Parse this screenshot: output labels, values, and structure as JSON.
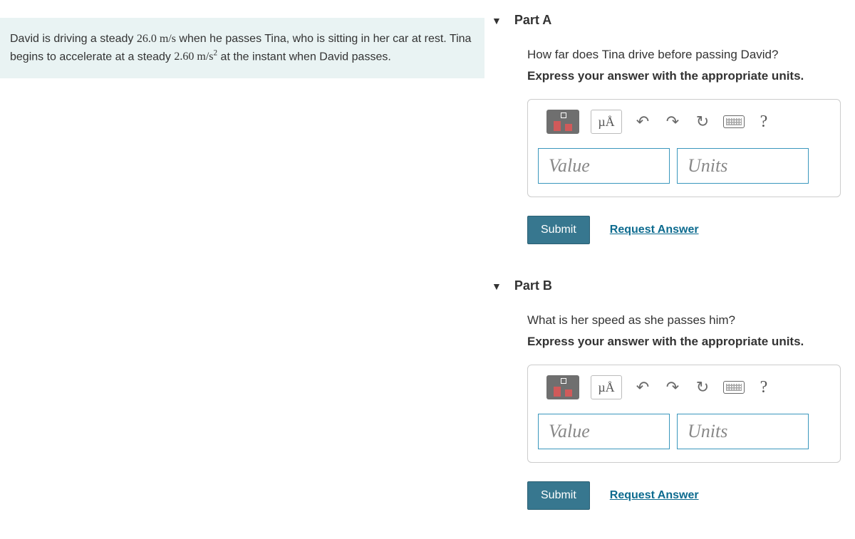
{
  "problem": {
    "text_before_v1": "David is driving a steady ",
    "v1": "26.0 m/s",
    "text_mid1": " when he passes Tina, who is sitting in her car at rest. Tina begins to accelerate at a steady ",
    "v2_num": "2.60 m/s",
    "v2_exp": "2",
    "text_after": " at the instant when David passes."
  },
  "parts": {
    "a": {
      "header": "Part A",
      "question": "How far does Tina drive before passing David?",
      "instruction": "Express your answer with the appropriate units.",
      "value_placeholder": "Value",
      "units_placeholder": "Units",
      "submit": "Submit",
      "request": "Request Answer",
      "mu": "µÅ",
      "help": "?"
    },
    "b": {
      "header": "Part B",
      "question": "What is her speed as she passes him?",
      "instruction": "Express your answer with the appropriate units.",
      "value_placeholder": "Value",
      "units_placeholder": "Units",
      "submit": "Submit",
      "request": "Request Answer",
      "mu": "µÅ",
      "help": "?"
    }
  }
}
